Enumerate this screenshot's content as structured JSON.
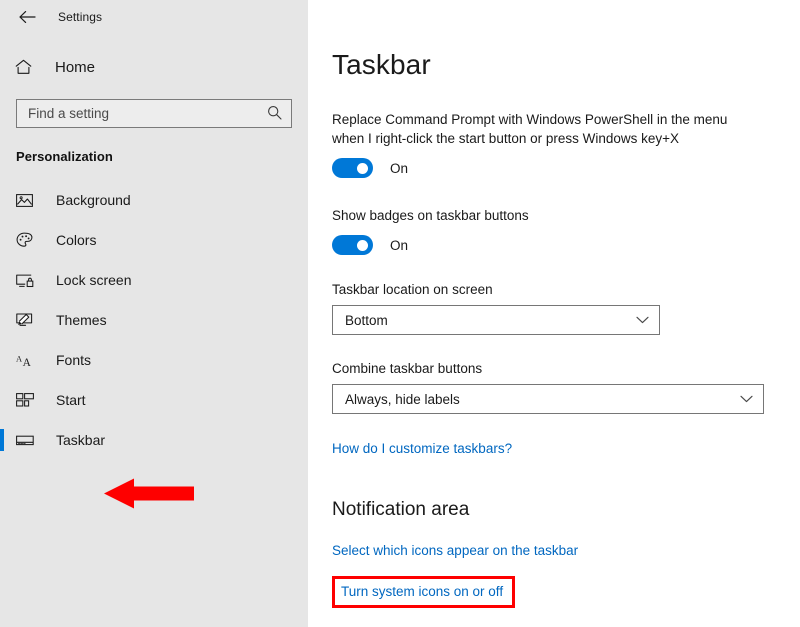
{
  "window": {
    "back_icon": "back-arrow-icon",
    "title": "Settings"
  },
  "sidebar": {
    "home": {
      "label": "Home",
      "icon": "home-icon"
    },
    "search": {
      "placeholder": "Find a setting",
      "value": "",
      "icon": "search-icon"
    },
    "section_label": "Personalization",
    "items": [
      {
        "label": "Background",
        "icon": "image-icon",
        "selected": false
      },
      {
        "label": "Colors",
        "icon": "palette-icon",
        "selected": false
      },
      {
        "label": "Lock screen",
        "icon": "lock-screen-icon",
        "selected": false
      },
      {
        "label": "Themes",
        "icon": "themes-brush-icon",
        "selected": false
      },
      {
        "label": "Fonts",
        "icon": "fonts-aa-icon",
        "selected": false
      },
      {
        "label": "Start",
        "icon": "start-tiles-icon",
        "selected": false
      },
      {
        "label": "Taskbar",
        "icon": "taskbar-bar-icon",
        "selected": true
      }
    ]
  },
  "main": {
    "title": "Taskbar",
    "settings": {
      "powershell": {
        "description": "Replace Command Prompt with Windows PowerShell in the menu when I right-click the start button or press Windows key+X",
        "toggle_state": "On"
      },
      "badges": {
        "description": "Show badges on taskbar buttons",
        "toggle_state": "On"
      },
      "location": {
        "label": "Taskbar location on screen",
        "value": "Bottom",
        "chevron": "chevron-down-icon"
      },
      "combine": {
        "label": "Combine taskbar buttons",
        "value": "Always, hide labels",
        "chevron": "chevron-down-icon"
      }
    },
    "help_link": "How do I customize taskbars?",
    "notification_area": {
      "heading": "Notification area",
      "select_icons_link": "Select which icons appear on the taskbar",
      "system_icons_link": "Turn system icons on or off"
    }
  },
  "annotations": {
    "arrow_color": "#fe0000",
    "highlight_box_color": "#fe0000",
    "accent_color": "#0078d7",
    "link_color": "#0067c0"
  }
}
